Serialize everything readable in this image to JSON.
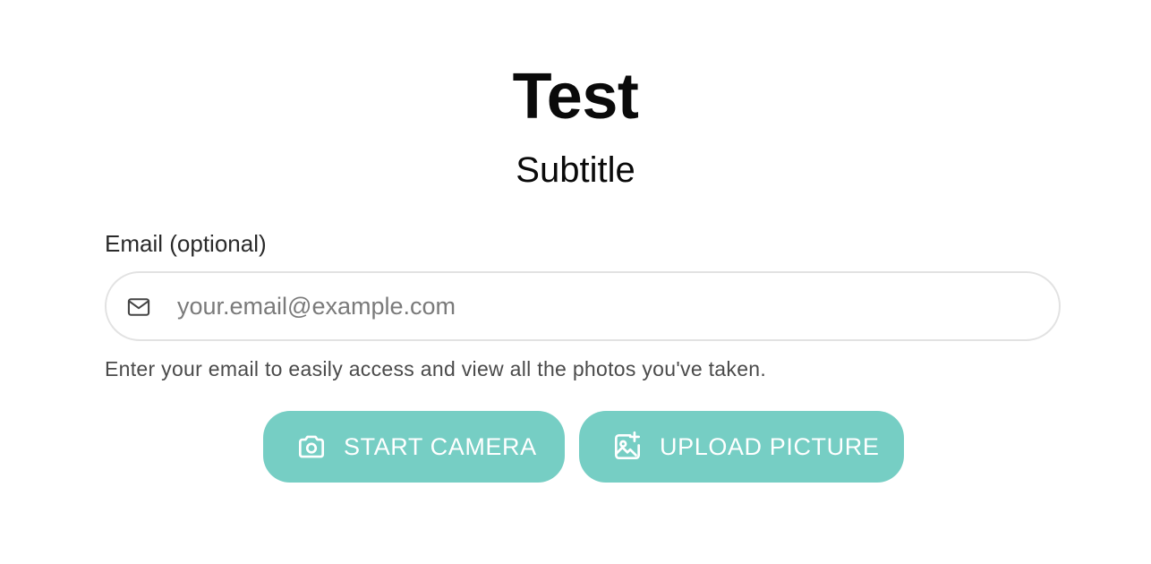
{
  "header": {
    "title": "Test",
    "subtitle": "Subtitle"
  },
  "email_field": {
    "label": "Email (optional)",
    "placeholder": "your.email@example.com",
    "value": "",
    "icon": "mail-icon",
    "helper_text": "Enter your email to easily access and view all the photos you've taken."
  },
  "actions": {
    "start_camera": {
      "label": "START CAMERA",
      "icon": "camera-icon"
    },
    "upload_picture": {
      "label": "UPLOAD PICTURE",
      "icon": "image-plus-icon"
    }
  },
  "colors": {
    "button_background": "#76cec4",
    "button_text": "#ffffff",
    "input_border": "#e2e2e2",
    "title_text": "#0a0a0a",
    "helper_text": "#4a4a4a"
  }
}
